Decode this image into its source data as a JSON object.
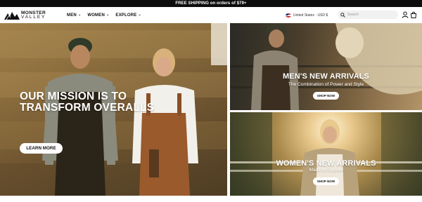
{
  "announcement": "FREE SHIPPING on orders of $79+",
  "brand": {
    "name_line1": "MONSTER",
    "name_line2": "VALLEY"
  },
  "nav": [
    {
      "label": "MEN",
      "chevron": "chevron-down-icon"
    },
    {
      "label": "WOMEN",
      "chevron": "chevron-down-icon"
    },
    {
      "label": "EXPLORE",
      "chevron": "chevron-down-icon"
    }
  ],
  "locale": {
    "label": "United States · USD $",
    "flag": "us-flag-icon"
  },
  "search": {
    "placeholder": "Search",
    "icon": "search-icon"
  },
  "header_icons": [
    "account-icon",
    "cart-icon"
  ],
  "hero": {
    "title_line1": "OUR MISSION IS TO",
    "title_line2": "TRANSFORM OVERALLS",
    "button": "LEARN MORE"
  },
  "men_panel": {
    "title": "MEN'S NEW ARRIVALS",
    "subtitle": "The Combination of Power and Style",
    "button": "SHOP NOW"
  },
  "women_panel": {
    "title": "WOMEN'S NEW ARRIVALS",
    "subtitle": "Made to Explore",
    "button": "SHOP NOW"
  },
  "colors": {
    "topbar": "#0d0d0d",
    "text": "#111111",
    "search_bg": "#f1f1f1",
    "accent_white": "#ffffff"
  }
}
